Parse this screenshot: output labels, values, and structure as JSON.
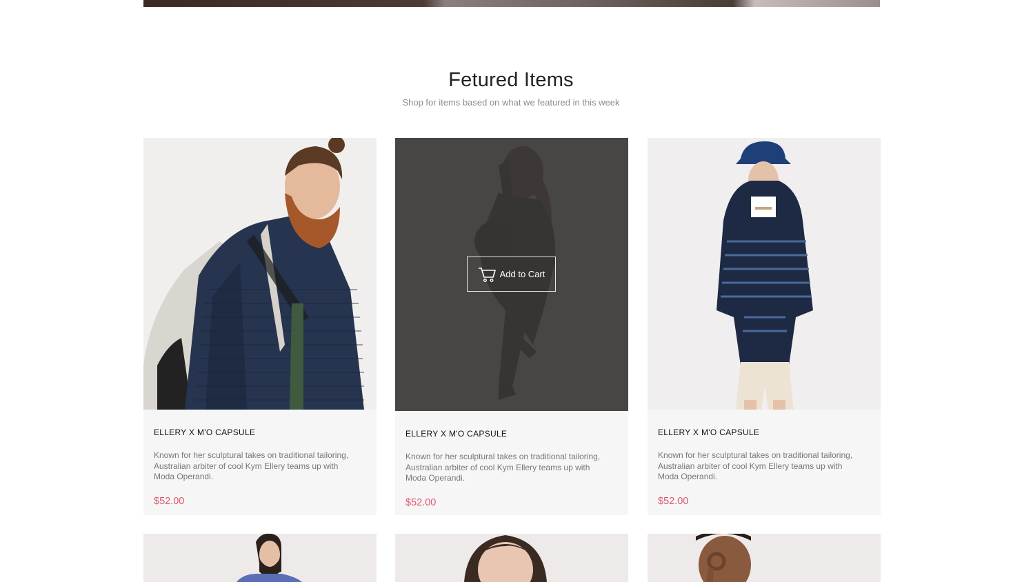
{
  "section": {
    "title": "Fetured Items",
    "subtitle": "Shop for items based on what we featured in this week"
  },
  "products": [
    {
      "name": "ELLERY X M'O CAPSULE",
      "description": "Known for her sculptural takes on traditional tailoring, Australian arbiter of cool Kym Ellery teams up with Moda Operandi.",
      "price": "$52.00"
    },
    {
      "name": "ELLERY X M'O CAPSULE",
      "description": "Known for her sculptural takes on traditional tailoring, Australian arbiter of cool Kym Ellery teams up with Moda Operandi.",
      "price": "$52.00",
      "hover_action": "Add to Cart"
    },
    {
      "name": "ELLERY X M'O CAPSULE",
      "description": "Known for her sculptural takes on traditional tailoring, Australian arbiter of cool Kym Ellery teams up with Moda Operandi.",
      "price": "$52.00"
    }
  ],
  "icons": {
    "cart": "shopping-cart-icon"
  },
  "colors": {
    "price": "#e0566e",
    "overlay": "#3a3636",
    "card_bg": "#f6f6f6"
  }
}
